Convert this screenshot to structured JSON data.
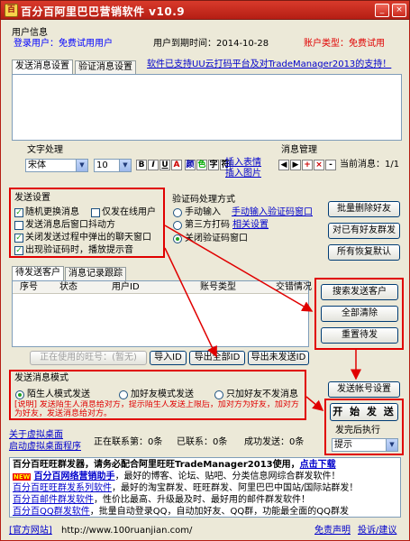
{
  "app": {
    "title": "百分百阿里巴巴营销软件 v10.9",
    "icon_letter": "百"
  },
  "window_controls": {
    "minimize": "_",
    "close": "×"
  },
  "user_info": {
    "group_label": "用户信息",
    "login_user": "登录用户：免费试用用户",
    "expire": "用户到期时间：2014-10-28",
    "account_type": "账户类型：免费试用"
  },
  "tabs": {
    "send_settings": "发送消息设置",
    "verify_settings": "验证消息设置"
  },
  "promo_link": "软件已支持UU云打码平台及对TradeManager2013的支持！",
  "text_format": {
    "label": "文字处理",
    "font": "宋体",
    "size": "10",
    "buttons": [
      "B",
      "I",
      "U",
      "A",
      "颜",
      "色",
      "字",
      "符"
    ],
    "insert_emoji": "插入表情",
    "insert_image": "插入图片"
  },
  "message_mgmt": {
    "label": "消息管理",
    "nav": [
      "◀",
      "▶",
      "+",
      "×",
      "-"
    ],
    "current": "当前消息：1/1"
  },
  "send_settings": {
    "label": "发送设置",
    "random_shuffle": "随机更换消息",
    "only_online": "仅发在线用户",
    "shake_window": "发送消息后窗口抖动方",
    "close_chat": "关闭发送过程中弹出的聊天窗口",
    "captcha_sound": "出现验证码时，播放提示音"
  },
  "captcha": {
    "label": "验证码处理方式",
    "manual": "手动输入",
    "manual_link": "手动输入验证码窗口",
    "third_party": "第三方打码",
    "third_link": "相关设置",
    "close_window": "关闭验证码窗口"
  },
  "right_buttons": {
    "batch_delete": "批量删除好友",
    "add_friend": "对已有好友群发",
    "restore_default": "所有恢复默认"
  },
  "list_tabs": {
    "pending": "待发送客户",
    "records": "消息记录跟踪"
  },
  "table": {
    "columns": [
      "序号",
      "状态",
      "用户ID",
      "账号类型",
      "交错情况"
    ]
  },
  "table_buttons": {
    "search": "搜索发送客户",
    "clear_all": "全部清除",
    "reset": "重置待发"
  },
  "bottom_bar": {
    "in_use": "正在使用的旺号：(暂无)",
    "import": "导入ID",
    "export_all": "导出全部ID",
    "export_unsent": "导出未发送ID"
  },
  "send_mode": {
    "label": "发送消息模式",
    "stranger": "陌生人模式发送",
    "add_friend": "加好友模式发送",
    "only_add": "只加好友不发消息",
    "note": "[说明] 发送陌生人消息给对方，提示陌生人发送上限后，加对方为好友，加对方为好友，发送消息给对方。"
  },
  "send_account_btn": "发送帐号设置",
  "start_btn": "开 始 发 送",
  "after_done": {
    "label": "发完后执行",
    "option": "提示"
  },
  "status": {
    "close_sim": "关于虚拟桌面",
    "start_sim": "启动虚拟桌面程序",
    "sending": "正在联系第：0条",
    "sent": "已联系：0条",
    "success": "成功发送：0条"
  },
  "news": {
    "line1": "百分百旺旺群发器，请务必配合阿里旺旺TradeManager2013使用，",
    "line1_link": "点击下载",
    "new_badge": "NEW",
    "line2_link": "百分百网络营销助手",
    "line2": "，最好的博客、论坛、贴吧、分类信息网综合群发软件！",
    "line3_link": "百分百旺旺群发系列软件",
    "line3": "，最好的淘宝群发、旺旺群发、阿里巴巴中国站/国际站群发！",
    "line4_link": "百分百邮件群发软件",
    "line4": "，性价比最高、升级最及时、最好用的邮件群发软件！",
    "line5_link": "百分百QQ群发软件",
    "line5": "，批量自动登录QQ，自动加好友、QQ群，功能最全面的QQ群发"
  },
  "footer": {
    "site_label": "[官方网站]",
    "site_url": "http://www.100ruanjian.com/",
    "disclaimer": "免责声明",
    "feedback": "投诉/建议"
  }
}
